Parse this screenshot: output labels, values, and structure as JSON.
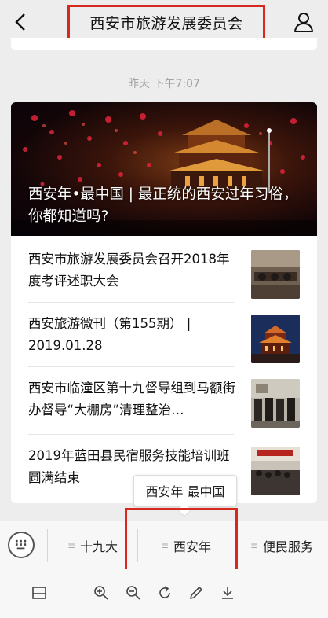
{
  "header": {
    "title": "西安市旅游发展委员会",
    "back_icon": "back-chevron-icon",
    "profile_icon": "person-icon"
  },
  "timestamp": "昨天 下午7:07",
  "article": {
    "cover_title": "西安年•最中国 | 最正统的西安过年习俗，你都知道吗?",
    "items": [
      {
        "title": "西安市旅游发展委员会召开2018年度考评述职大会"
      },
      {
        "title": "西安旅游微刊（第155期） | 2019.01.28"
      },
      {
        "title": "西安市临潼区第十九督导组到马额街办督导“大棚房”清理整治…"
      },
      {
        "title": "2019年蓝田县民宿服务技能培训班圆满结束"
      }
    ]
  },
  "popup": {
    "label": "西安年 最中国"
  },
  "menu": {
    "keyboard_icon": "keyboard-icon",
    "items": [
      {
        "label": "十九大"
      },
      {
        "label": "西安年"
      },
      {
        "label": "便民服务"
      }
    ]
  },
  "toolbar": {
    "icons": [
      "window-icon",
      "zoom-in-icon",
      "zoom-out-icon",
      "rotate-icon",
      "pencil-icon",
      "download-icon"
    ]
  },
  "colors": {
    "highlight": "#d6281f",
    "background": "#ededed"
  }
}
